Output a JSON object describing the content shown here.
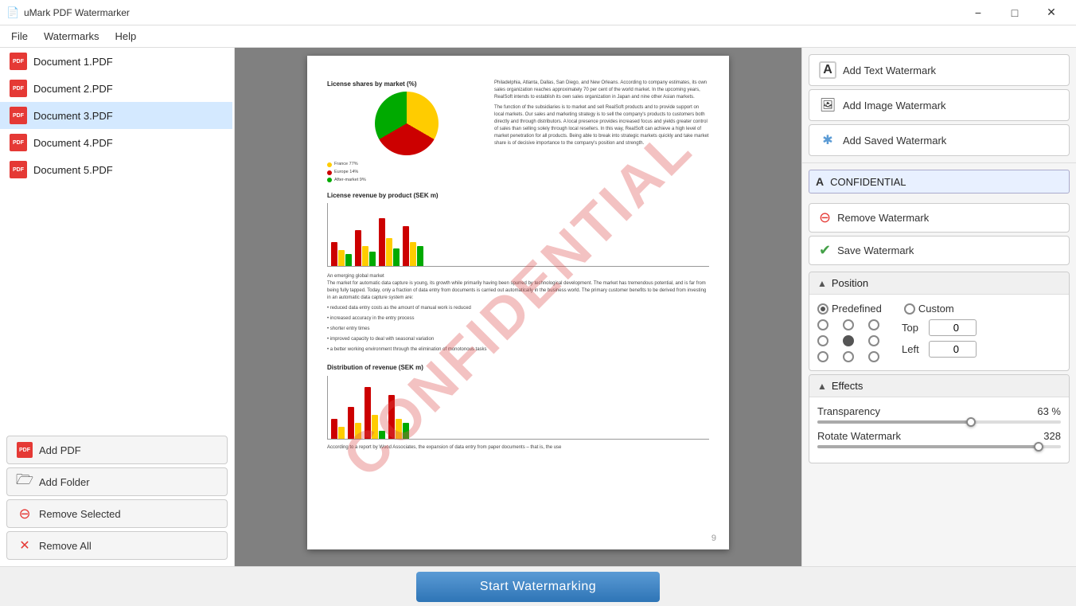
{
  "app": {
    "title": "uMark PDF Watermarker",
    "icon": "📄"
  },
  "titlebar": {
    "minimize_label": "−",
    "maximize_label": "□",
    "close_label": "✕"
  },
  "menubar": {
    "items": [
      "File",
      "Watermarks",
      "Help"
    ]
  },
  "sidebar": {
    "files": [
      {
        "name": "Document 1.PDF",
        "selected": false
      },
      {
        "name": "Document 2.PDF",
        "selected": false
      },
      {
        "name": "Document 3.PDF",
        "selected": true
      },
      {
        "name": "Document 4.PDF",
        "selected": false
      },
      {
        "name": "Document 5.PDF",
        "selected": false
      }
    ],
    "buttons": [
      {
        "id": "add-pdf",
        "label": "Add PDF",
        "icon_type": "pdf"
      },
      {
        "id": "add-folder",
        "label": "Add Folder",
        "icon_type": "folder"
      },
      {
        "id": "remove-selected",
        "label": "Remove Selected",
        "icon_type": "remove"
      },
      {
        "id": "remove-all",
        "label": "Remove All",
        "icon_type": "remove-all"
      }
    ]
  },
  "preview": {
    "watermark_text": "CONFIDENTIAL",
    "page_number": "9"
  },
  "right_panel": {
    "buttons": [
      {
        "id": "add-text",
        "label": "Add Text Watermark",
        "icon": "A"
      },
      {
        "id": "add-image",
        "label": "Add Image Watermark",
        "icon": "🖼"
      },
      {
        "id": "add-saved",
        "label": "Add Saved Watermark",
        "icon": "✱"
      }
    ],
    "watermark_item": {
      "icon": "A",
      "label": "CONFIDENTIAL"
    },
    "actions": [
      {
        "id": "remove-watermark",
        "label": "Remove Watermark",
        "icon": "remove"
      },
      {
        "id": "save-watermark",
        "label": "Save Watermark",
        "icon": "save"
      }
    ],
    "position": {
      "section_title": "Position",
      "predefined_label": "Predefined",
      "custom_label": "Custom",
      "top_label": "Top",
      "left_label": "Left",
      "top_value": "0",
      "left_value": "0",
      "grid_selected": 4
    },
    "effects": {
      "section_title": "Effects",
      "transparency_label": "Transparency",
      "transparency_value": "63 %",
      "transparency_pct": 63,
      "rotate_label": "Rotate Watermark",
      "rotate_value": "328"
    }
  },
  "bottom": {
    "start_label": "Start Watermarking"
  }
}
